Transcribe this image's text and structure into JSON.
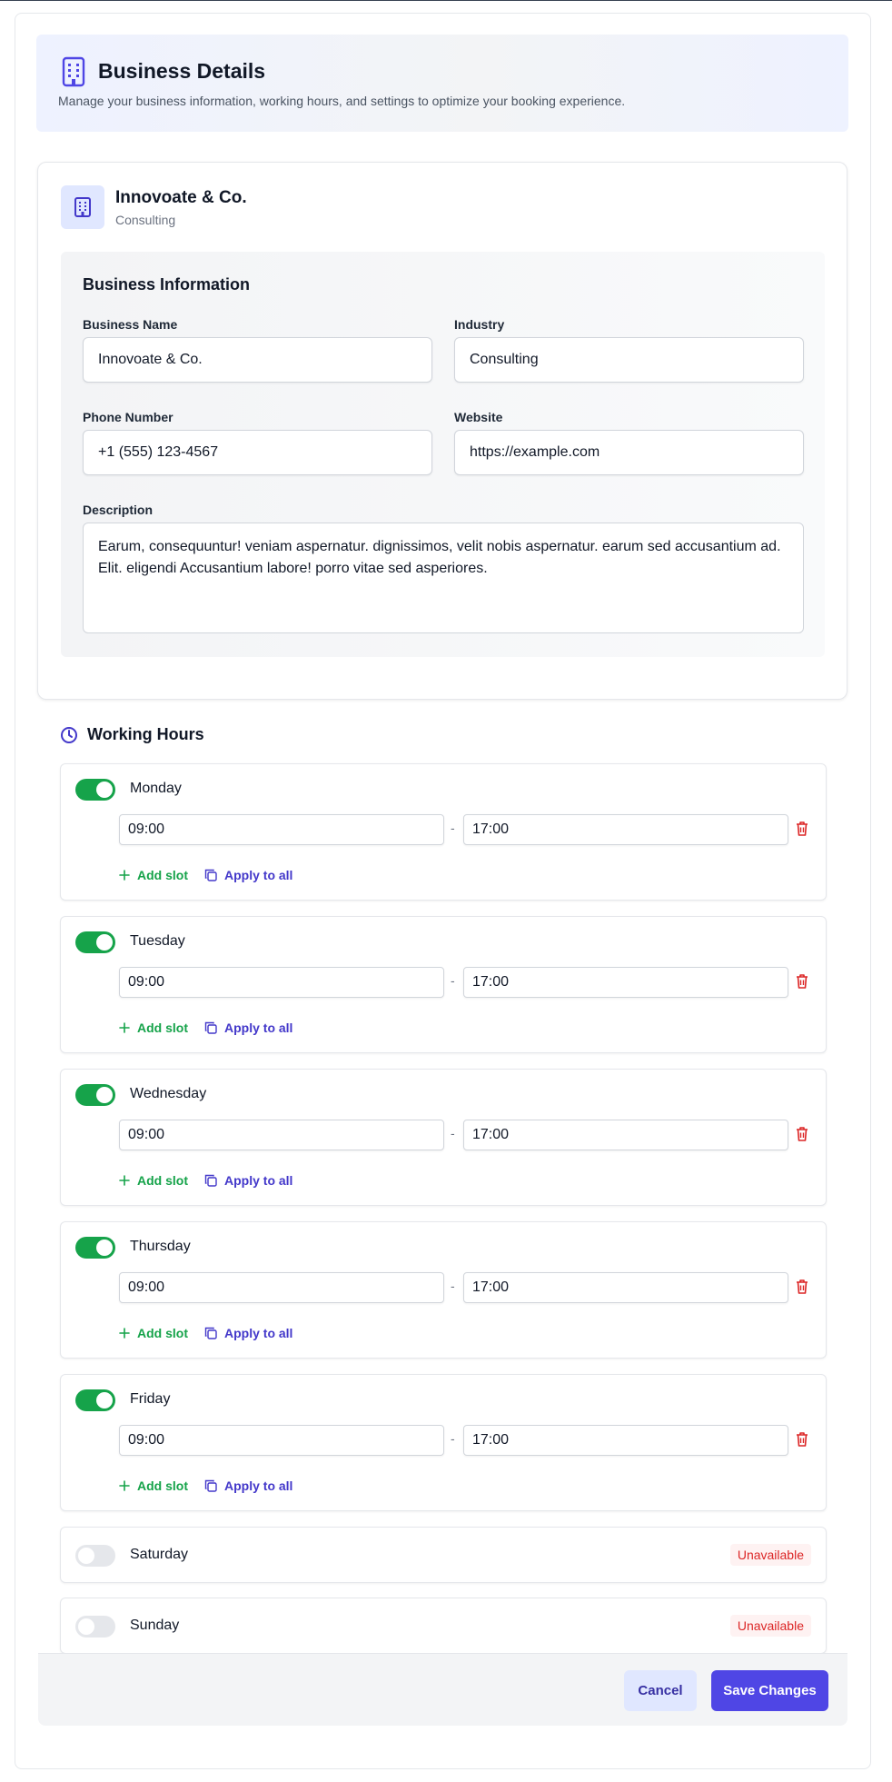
{
  "header": {
    "title": "Business Details",
    "subtitle": "Manage your business information, working hours, and settings to optimize your booking experience."
  },
  "business": {
    "name": "Innovoate & Co.",
    "industry": "Consulting"
  },
  "info": {
    "title": "Business Information",
    "business_name_label": "Business Name",
    "business_name_value": "Innovoate & Co.",
    "industry_label": "Industry",
    "industry_value": "Consulting",
    "phone_label": "Phone Number",
    "phone_value": "+1 (555) 123-4567",
    "website_label": "Website",
    "website_value": "https://example.com",
    "description_label": "Description",
    "description_value": "Earum, consequuntur! veniam aspernatur. dignissimos, velit nobis aspernatur. earum sed accusantium ad. Elit. eligendi Accusantium labore! porro vitae sed asperiores."
  },
  "working_hours": {
    "title": "Working Hours",
    "add_slot_label": "Add slot",
    "apply_all_label": "Apply to all",
    "unavailable_label": "Unavailable",
    "separator": "-",
    "days": [
      {
        "name": "Monday",
        "enabled": true,
        "start": "09:00",
        "end": "17:00"
      },
      {
        "name": "Tuesday",
        "enabled": true,
        "start": "09:00",
        "end": "17:00"
      },
      {
        "name": "Wednesday",
        "enabled": true,
        "start": "09:00",
        "end": "17:00"
      },
      {
        "name": "Thursday",
        "enabled": true,
        "start": "09:00",
        "end": "17:00"
      },
      {
        "name": "Friday",
        "enabled": true,
        "start": "09:00",
        "end": "17:00"
      },
      {
        "name": "Saturday",
        "enabled": false
      },
      {
        "name": "Sunday",
        "enabled": false
      }
    ]
  },
  "footer": {
    "cancel_label": "Cancel",
    "save_label": "Save Changes"
  },
  "colors": {
    "accent": "#4f46e5",
    "success": "#16a34a",
    "danger": "#dc2626"
  },
  "icons": {
    "header": "building-icon",
    "logo": "building-icon",
    "hours": "clock-icon",
    "add": "plus-icon",
    "apply": "copy-icon",
    "delete": "trash-icon"
  }
}
